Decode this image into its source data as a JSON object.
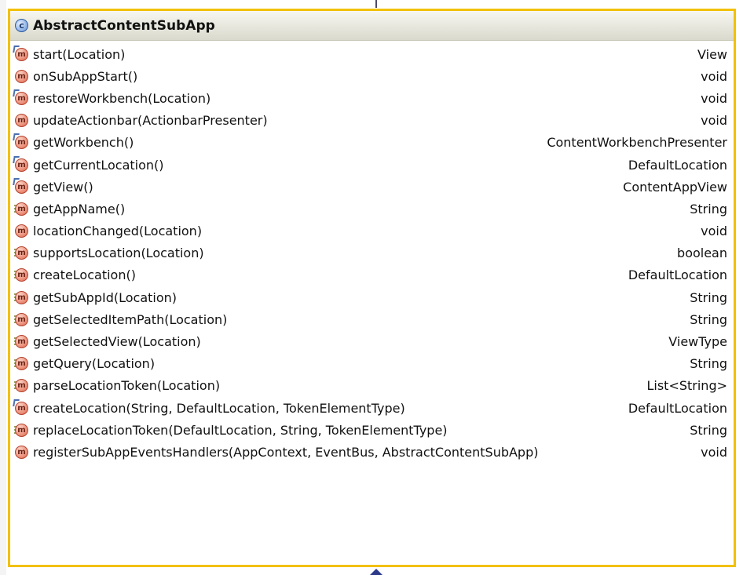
{
  "class": {
    "name": "AbstractContentSubApp",
    "icon": "class-icon",
    "icon_letter": "c"
  },
  "colors": {
    "border": "#f2c100",
    "method_icon": "#e0654a",
    "class_icon": "#5d8fd8"
  },
  "methods": [
    {
      "signature": "start(Location)",
      "returns": "View",
      "icon": "method-override-icon",
      "icon_letter": "m"
    },
    {
      "signature": "onSubAppStart()",
      "returns": "void",
      "icon": "method-icon",
      "icon_letter": "m"
    },
    {
      "signature": "restoreWorkbench(Location)",
      "returns": "void",
      "icon": "method-override-icon",
      "icon_letter": "m"
    },
    {
      "signature": "updateActionbar(ActionbarPresenter)",
      "returns": "void",
      "icon": "method-icon",
      "icon_letter": "m"
    },
    {
      "signature": "getWorkbench()",
      "returns": "ContentWorkbenchPresenter",
      "icon": "method-override-icon",
      "icon_letter": "m"
    },
    {
      "signature": "getCurrentLocation()",
      "returns": "DefaultLocation",
      "icon": "method-override-icon",
      "icon_letter": "m"
    },
    {
      "signature": "getView()",
      "returns": "ContentAppView",
      "icon": "method-override-icon",
      "icon_letter": "m"
    },
    {
      "signature": "getAppName()",
      "returns": "String",
      "icon": "method-implement-icon",
      "icon_letter": "m"
    },
    {
      "signature": "locationChanged(Location)",
      "returns": "void",
      "icon": "method-icon",
      "icon_letter": "m"
    },
    {
      "signature": "supportsLocation(Location)",
      "returns": "boolean",
      "icon": "method-implement-icon",
      "icon_letter": "m"
    },
    {
      "signature": "createLocation()",
      "returns": "DefaultLocation",
      "icon": "method-implement-icon",
      "icon_letter": "m"
    },
    {
      "signature": "getSubAppId(Location)",
      "returns": "String",
      "icon": "method-implement-icon",
      "icon_letter": "m"
    },
    {
      "signature": "getSelectedItemPath(Location)",
      "returns": "String",
      "icon": "method-implement-icon",
      "icon_letter": "m"
    },
    {
      "signature": "getSelectedView(Location)",
      "returns": "ViewType",
      "icon": "method-implement-icon",
      "icon_letter": "m"
    },
    {
      "signature": "getQuery(Location)",
      "returns": "String",
      "icon": "method-implement-icon",
      "icon_letter": "m"
    },
    {
      "signature": "parseLocationToken(Location)",
      "returns": "List<String>",
      "icon": "method-implement-icon",
      "icon_letter": "m"
    },
    {
      "signature": "createLocation(String, DefaultLocation, TokenElementType)",
      "returns": "DefaultLocation",
      "icon": "method-override-icon",
      "icon_letter": "m"
    },
    {
      "signature": "replaceLocationToken(DefaultLocation, String, TokenElementType)",
      "returns": "String",
      "icon": "method-implement-icon",
      "icon_letter": "m"
    },
    {
      "signature": "registerSubAppEventsHandlers(AppContext, EventBus, AbstractContentSubApp)",
      "returns": "void",
      "icon": "method-icon",
      "icon_letter": "m"
    }
  ]
}
